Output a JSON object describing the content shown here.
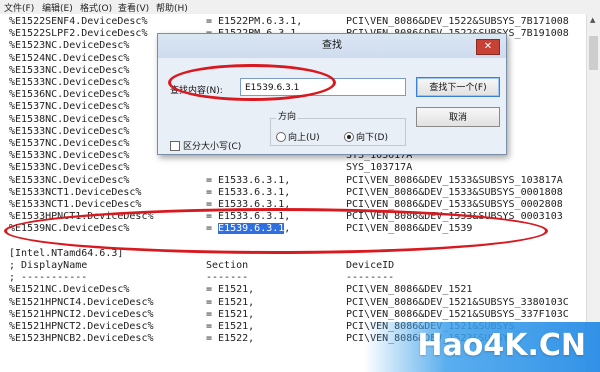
{
  "menu": {
    "items": [
      "文件(F)",
      "编辑(E)",
      "格式(O)",
      "查看(V)",
      "帮助(H)"
    ]
  },
  "editor": {
    "lines": [
      {
        "name": "%E1522SENF4.DeviceDesc%",
        "section": "= E1522PM.6.3.1,",
        "device": "PCI\\VEN_8086&DEV_1522&SUBSYS_7B171008"
      },
      {
        "name": "%E1522SLPF2.DeviceDesc%",
        "section": "= E1522PM.6.3.1,",
        "device": "PCI\\VEN_8086&DEV_1522&SUBSYS_7B191008"
      },
      {
        "name": "%E1523NC.DeviceDesc%",
        "section": "",
        "device": ""
      },
      {
        "name": "%E1524NC.DeviceDesc%",
        "section": "",
        "device": ""
      },
      {
        "name": "%E1533NC.DeviceDesc%",
        "section": "",
        "device": ""
      },
      {
        "name": "%E1533NC.DeviceDesc%",
        "section": "",
        "device": "SYS_153315D"
      },
      {
        "name": "%E1536NC.DeviceDesc%",
        "section": "",
        "device": ""
      },
      {
        "name": "%E1537NC.DeviceDesc%",
        "section": "",
        "device": ""
      },
      {
        "name": "%E1538NC.DeviceDesc%",
        "section": "",
        "device": ""
      },
      {
        "name": "%E1533NC.DeviceDesc%",
        "section": "",
        "device": ""
      },
      {
        "name": "%E1537NC.DeviceDesc%",
        "section": "",
        "device": ""
      },
      {
        "name": "%E1533NC.DeviceDesc%",
        "section": "",
        "device": "SYS_103617A"
      },
      {
        "name": "%E1533NC.DeviceDesc%",
        "section": "",
        "device": "SYS_103717A"
      },
      {
        "name": "%E1533NC.DeviceDesc%",
        "section": "= E1533.6.3.1,",
        "device": "PCI\\VEN_8086&DEV_1533&SUBSYS_103817A"
      },
      {
        "name": "%E1533NCT1.DeviceDesc%",
        "section": "= E1533.6.3.1,",
        "device": "PCI\\VEN_8086&DEV_1533&SUBSYS_0001808"
      },
      {
        "name": "%E1533NCT1.DeviceDesc%",
        "section": "= E1533.6.3.1,",
        "device": "PCI\\VEN_8086&DEV_1533&SUBSYS_0002808"
      },
      {
        "name": "%E1533HPNCT1.DeviceDesc%",
        "section": "= E1533.6.3.1,",
        "device": "PCI\\VEN_8086&DEV_1533&SUBSYS_0003103"
      },
      {
        "name": "%E1539NC.DeviceDesc%",
        "section": "= E1539.6.3.1,",
        "device": "PCI\\VEN_8086&DEV_1539"
      },
      {
        "name": "",
        "section": "",
        "device": ""
      },
      {
        "name": "[Intel.NTamd64.6.3]",
        "section": "",
        "device": ""
      },
      {
        "name": "; DisplayName",
        "section": "Section",
        "device": "DeviceID"
      },
      {
        "name": "; -----------",
        "section": "-------",
        "device": "--------"
      },
      {
        "name": "%E1521NC.DeviceDesc%",
        "section": "= E1521,",
        "device": "PCI\\VEN_8086&DEV_1521"
      },
      {
        "name": "%E1521HPNCI4.DeviceDesc%",
        "section": "= E1521,",
        "device": "PCI\\VEN_8086&DEV_1521&SUBSYS_3380103C"
      },
      {
        "name": "%E1521HPNCI2.DeviceDesc%",
        "section": "= E1521,",
        "device": "PCI\\VEN_8086&DEV_1521&SUBSYS_337F103C"
      },
      {
        "name": "%E1521HPNCT2.DeviceDesc%",
        "section": "= E1521,",
        "device": "PCI\\VEN_8086&DEV_1521&SUBSYS_"
      },
      {
        "name": "%E1523HPNCB2.DeviceDesc%",
        "section": "= E1522,",
        "device": "PCI\\VEN_8086&DEV_1523&SUBSYS_"
      }
    ],
    "highlighted_text": "E1539.6.3.1"
  },
  "dialog": {
    "title": "查找",
    "close_icon": "close-icon",
    "find_label": "查找内容(N):",
    "find_value": "E1539.6.3.1",
    "find_next_label": "查找下一个(F)",
    "cancel_label": "取消",
    "direction_label": "方向",
    "up_label": "向上(U)",
    "down_label": "向下(D)",
    "direction_selected": "down",
    "match_case_label": "区分大小写(C)",
    "match_case_checked": false
  },
  "annotations": {
    "color": "#d8191f"
  },
  "watermark": {
    "text": "Hao4K.CN"
  }
}
